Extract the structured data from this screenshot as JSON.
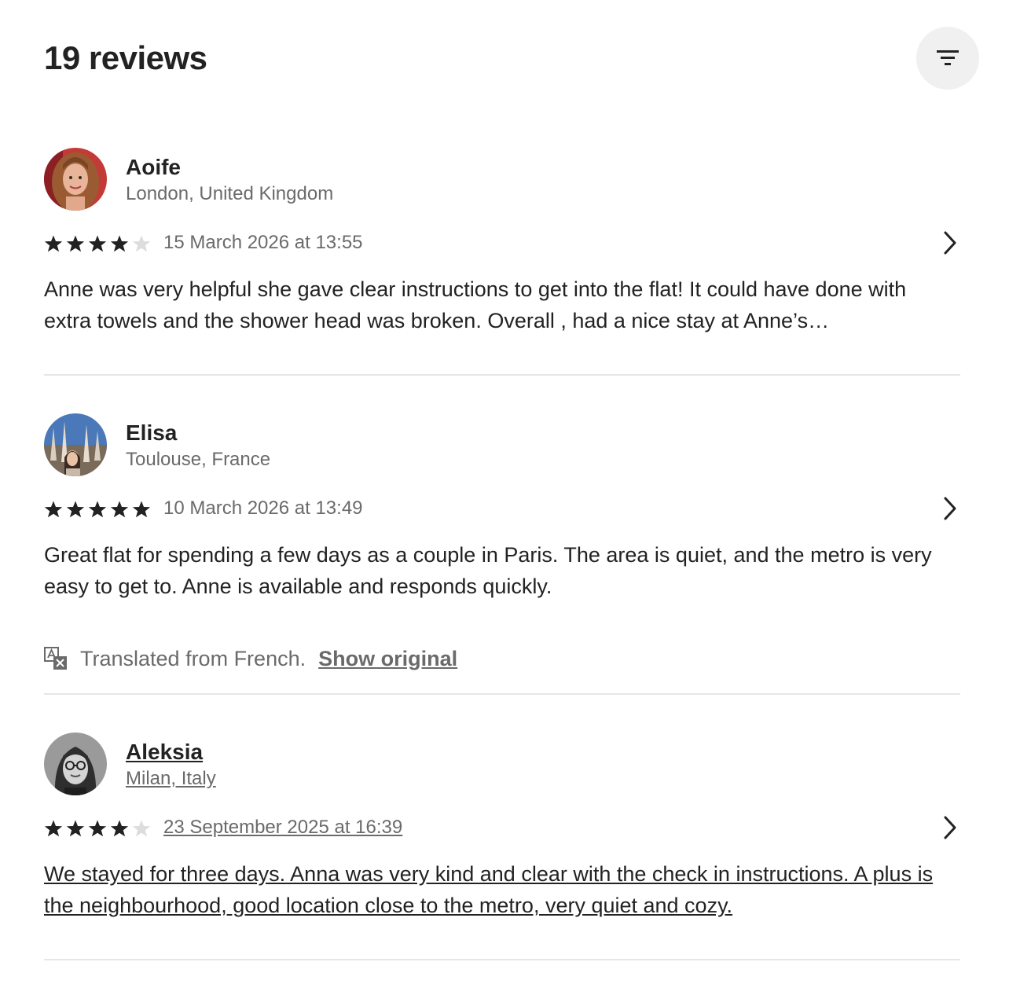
{
  "header": {
    "title": "19 reviews",
    "filter_icon": "filter-icon"
  },
  "reviews": [
    {
      "name": "Aoife",
      "location": "London, United Kingdom",
      "rating": 4,
      "date": "15 March 2026 at 13:55",
      "text": "Anne was very helpful she gave clear instructions to get into the flat! It could have done with extra towels and the shower head was broken. Overall , had a nice stay at Anne’s…"
    },
    {
      "name": "Elisa",
      "location": "Toulouse, France",
      "rating": 5,
      "date": "10 March 2026 at 13:49",
      "text": "Great flat for spending a few days as a couple in Paris. The area is quiet, and the metro is very easy to get to. Anne is available and responds quickly.",
      "translation_note": "Translated from French.",
      "show_original_label": "Show original"
    },
    {
      "name": "Aleksia",
      "location": "Milan, Italy",
      "rating": 4,
      "date": "23 September 2025 at 16:39",
      "text": "We stayed for three days. Anna was very kind and clear with the check in instructions. A plus is the neighbourhood, good location close to the metro, very quiet and cozy."
    }
  ],
  "colors": {
    "text_primary": "#222222",
    "text_secondary": "#6a6a6a",
    "star_filled": "#222222",
    "star_empty": "#dddddd",
    "divider": "#e6e6e6",
    "filter_bg": "#f0f0f0"
  }
}
